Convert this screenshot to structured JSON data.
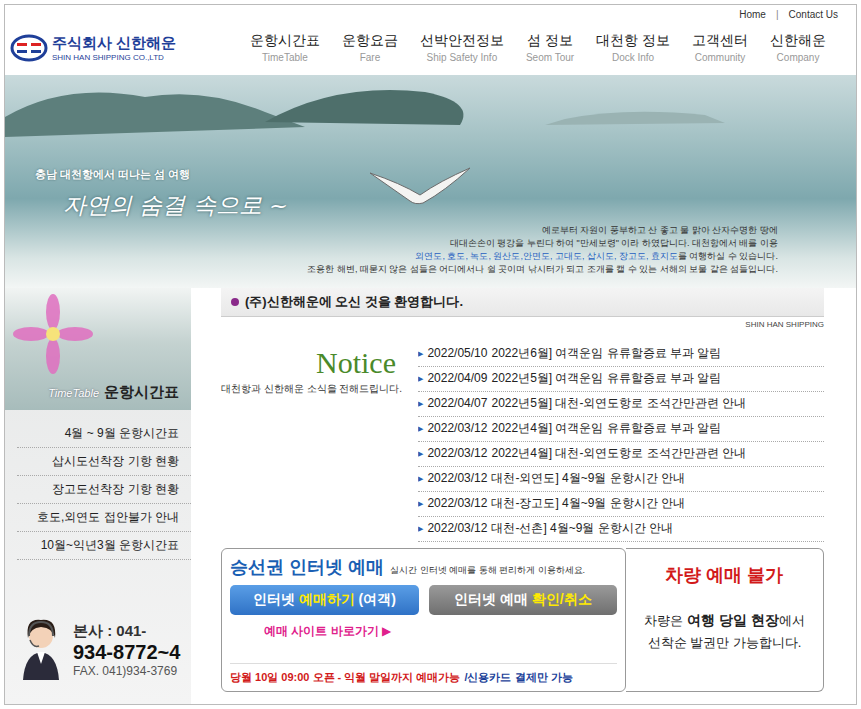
{
  "top_links": {
    "items": [
      "Home",
      "Contact Us"
    ],
    "separator": "|"
  },
  "logo": {
    "name": "주식회사 신한해운",
    "english": "SHIN HAN SHIPPING CO.,LTD"
  },
  "nav": [
    {
      "label": "운항시간표",
      "sub": "TimeTable"
    },
    {
      "label": "운항요금",
      "sub": "Fare"
    },
    {
      "label": "선박안전정보",
      "sub": "Ship Safety Info"
    },
    {
      "label": "섬 정보",
      "sub": "Seom Tour"
    },
    {
      "label": "대천항 정보",
      "sub": "Dock Info"
    },
    {
      "label": "고객센터",
      "sub": "Community"
    },
    {
      "label": "신한해운",
      "sub": "Company"
    }
  ],
  "hero": {
    "subtitle": "충남 대천항에서 떠나는 섬 여행",
    "tagline": "자연의 숨결 속으로 ~",
    "lines": [
      [
        {
          "text": "예로부터 자원이 풍부하고 산 좋고 물 맑아 산자수명한 땅에",
          "highlight": false
        }
      ],
      [
        {
          "text": "대대손손이 평강을 누린다 하여 \"만세보령\" 이라 하였답니다. 대천항에서 배를 이용",
          "highlight": false
        }
      ],
      [
        {
          "text": "외연도, 호도, 녹도, 원산도,안면도, 고대도, 삽시도, 장고도, 효지도",
          "highlight": true
        },
        {
          "text": "를 여행하실 수 있습니다.",
          "highlight": false
        }
      ],
      [
        {
          "text": "조용한 해변, 때묻지 않은 섬들은 어디에서나 쉴 곳이며 낚시터가 되고 조개를 캘 수 있는 서해의 보물 같은 섬들입니다.",
          "highlight": false
        }
      ]
    ]
  },
  "welcome": {
    "text": "(주)신한해운에 오신 것을 환영합니다.",
    "brand": "SHIN HAN SHIPPING"
  },
  "sidebar": {
    "title_en": "TimeTable",
    "title": "운항시간표",
    "items": [
      "4월 ~ 9월 운항시간표",
      "삽시도선착장 기항 현황",
      "장고도선착장 기항 현황",
      "호도,외연도 접안불가 안내",
      "10월~익년3월 운항시간표"
    ],
    "contact": {
      "label": "본사 : 041-",
      "number": "934-8772~4",
      "fax": "FAX. 041)934-3769"
    }
  },
  "notice": {
    "title": "Notice",
    "subtitle": "대천항과 신한해운 소식을 전해드립니다.",
    "bullet": "▶",
    "items": [
      {
        "date": "2022/05/10",
        "title": "2022년6월] 여객운임 유류할증료 부과 알림"
      },
      {
        "date": "2022/04/09",
        "title": "2022년5월] 여객운임 유류할증료 부과 알림"
      },
      {
        "date": "2022/04/07",
        "title": "2022년5월] 대천-외연도항로 조석간만관련 안내"
      },
      {
        "date": "2022/03/12",
        "title": "2022년4월] 여객운임 유류할증료 부과 알림"
      },
      {
        "date": "2022/03/12",
        "title": "2022년4월] 대천-외연도항로 조석간만관련 안내"
      },
      {
        "date": "2022/03/12",
        "title": "대천-외연도] 4월~9월 운항시간 안내"
      },
      {
        "date": "2022/03/12",
        "title": "대천-장고도] 4월~9월 운항시간 안내"
      },
      {
        "date": "2022/03/12",
        "title": "대천-선촌] 4월~9월 운항시간 안내"
      }
    ]
  },
  "booking": {
    "title": "승선권 인터넷 예매",
    "desc": "실시간 인터넷 예매를 통해 편리하게 이용하세요.",
    "buttons": [
      {
        "kind": "primary",
        "parts": [
          {
            "text": "인터넷 ",
            "highlight": false
          },
          {
            "text": "예매하기",
            "highlight": true
          },
          {
            "text": " (여객)",
            "highlight": false
          }
        ]
      },
      {
        "kind": "secondary",
        "parts": [
          {
            "text": "인터넷 예매 ",
            "highlight": false
          },
          {
            "text": "확인/취소",
            "highlight": true
          }
        ]
      }
    ],
    "link": "예매 사이트 바로가기 ▶",
    "notice": "당월 10일 09:00 오픈 - 익월 말일까지 예매가능",
    "payment": "/신용카드 결제만 가능"
  },
  "vehicle": {
    "title": "차량 예매 불가",
    "lines": [
      [
        {
          "text": "차량은 ",
          "bold": false
        },
        {
          "text": "여행 당일 현장",
          "bold": true
        },
        {
          "text": "에서",
          "bold": false
        }
      ],
      [
        {
          "text": "선착순 발권만 가능합니다.",
          "bold": false
        }
      ]
    ]
  }
}
